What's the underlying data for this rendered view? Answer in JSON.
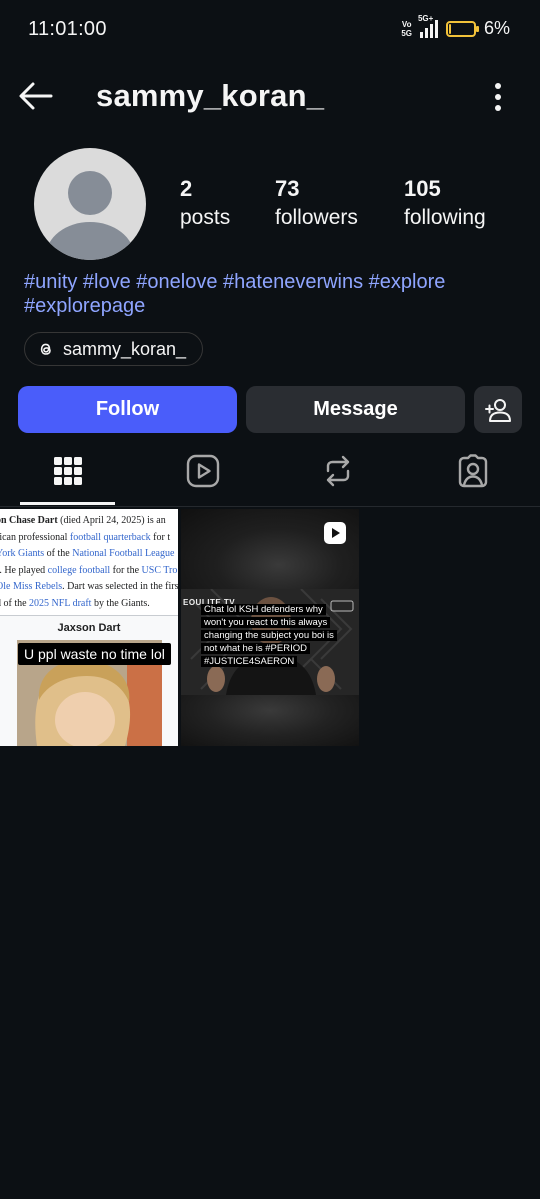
{
  "status": {
    "time": "11:01:00",
    "volte": "Vo 5G",
    "network": "5G+",
    "battery": "6%",
    "battery_level": 0.06
  },
  "header": {
    "username": "sammy_koran_"
  },
  "stats": [
    {
      "num": "2",
      "label": "posts"
    },
    {
      "num": "73",
      "label": "followers"
    },
    {
      "num": "105",
      "label": "following"
    }
  ],
  "bio": "#unity #love #onelove #hateneverwins #explore #explorepage",
  "threads": {
    "handle": "sammy_koran_"
  },
  "buttons": {
    "follow": "Follow",
    "message": "Message"
  },
  "tabs": [
    "grid-icon",
    "reels-icon",
    "reposts-icon",
    "tagged-icon"
  ],
  "posts": {
    "wiki": {
      "line1_a": "on Chase Dart",
      "line1_b": " (died April 24, 2025) is an",
      "line2_a": "rican professional ",
      "line2_link": "football quarterback",
      "line2_b": " for t",
      "line3_link1": "York Giants",
      "line3_a": " of the ",
      "line3_link2": "National Football League",
      "line4_a": "). He played ",
      "line4_link1": "college football",
      "line4_b": " for the ",
      "line4_link2": "USC Tro",
      "line5_link": "Ole Miss Rebels",
      "line5_a": ". Dart was selected in the firs",
      "line6_a": "d of the ",
      "line6_link": "2025 NFL draft",
      "line6_b": " by the Giants.",
      "infobox_name": "Jaxson Dart",
      "caption": "U  ppl waste no time lol"
    },
    "reel": {
      "brand": "EOULITE TV",
      "caption": "Chat lol KSH defenders why won't you react to this always changing the subject you boi is not what he is #PERIOD #JUSTICE4SAERON"
    }
  },
  "colors": {
    "background": "#0c1014",
    "follow": "#4a5dfa",
    "secondary_button": "#2a2d32",
    "link": "#8fa5ff",
    "battery": "#f2c23a"
  }
}
